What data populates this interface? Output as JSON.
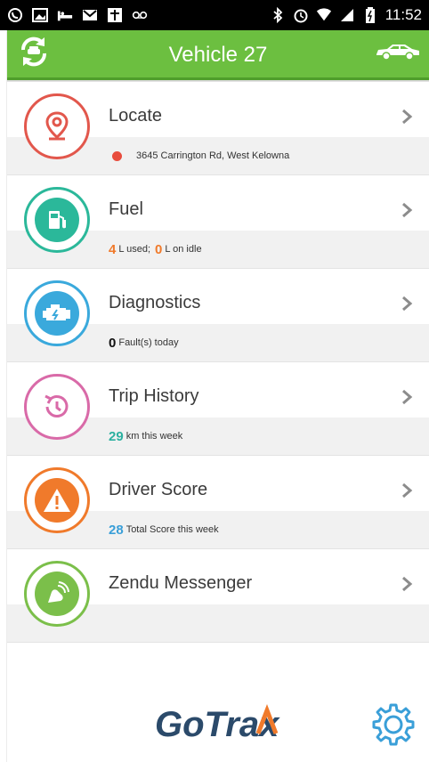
{
  "status": {
    "time": "11:52"
  },
  "header": {
    "title": "Vehicle 27"
  },
  "colors": {
    "green": "#6cbf40",
    "locate": "#e2574c",
    "fuel": "#2bb89a",
    "diagnostics": "#3aa9dc",
    "trip": "#d96aa8",
    "score": "#f07a2b",
    "messenger": "#7bbf4a",
    "orange": "#f07a2b",
    "teal": "#2bb0a0",
    "blue": "#3a9fd8"
  },
  "menu": {
    "locate": {
      "label": "Locate",
      "address": "3645 Carrington Rd, West Kelowna",
      "icon": "location-pin-icon"
    },
    "fuel": {
      "label": "Fuel",
      "used_value": "4",
      "used_unit": "L used;",
      "idle_value": "0",
      "idle_unit": "L on idle",
      "icon": "fuel-pump-icon"
    },
    "diagnostics": {
      "label": "Diagnostics",
      "value": "0",
      "unit": "Fault(s) today",
      "icon": "engine-icon"
    },
    "trip": {
      "label": "Trip History",
      "value": "29",
      "unit": "km this week",
      "icon": "history-icon"
    },
    "score": {
      "label": "Driver Score",
      "value": "28",
      "unit": "Total Score this week",
      "icon": "warning-icon"
    },
    "messenger": {
      "label": "Zendu Messenger",
      "icon": "messenger-icon"
    }
  },
  "footer": {
    "logo": "GoTrax"
  }
}
